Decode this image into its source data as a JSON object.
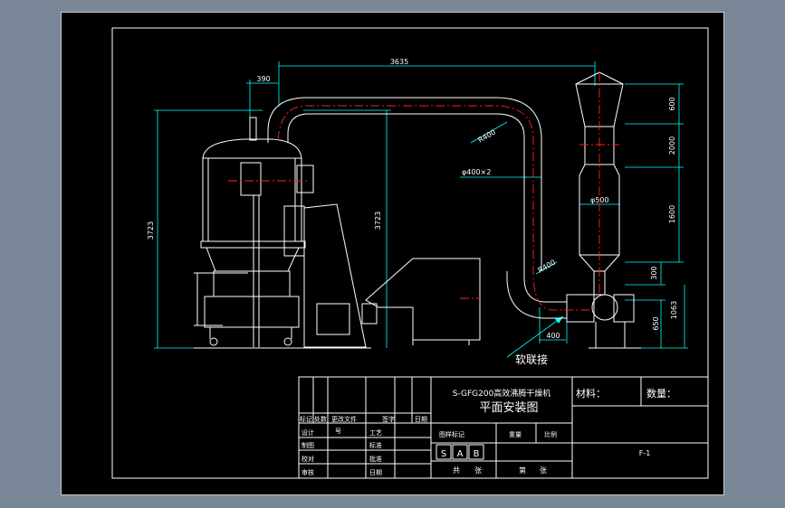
{
  "colors": {
    "background": "#000000",
    "frame": "#ffffff",
    "dimension": "#00ffff",
    "centerline": "#ff2020",
    "outside": "#7a8798"
  },
  "dimensions": {
    "total_length": "3635",
    "offset": "390",
    "height_left": "3723",
    "height_mid": "3723",
    "bend_top": "R400",
    "pipe": "φ400×2",
    "bend_bottom": "R400",
    "fan_offset": "400",
    "chimney_dia": "φ500",
    "right_dims": [
      "600",
      "2000",
      "1600",
      "300"
    ],
    "fan_height": "650",
    "base_height": "1063"
  },
  "callout": "软联接",
  "title_block": {
    "machine_name": "S-GFG200高效沸腾干燥机",
    "drawing_title": "平面安装图",
    "material_label": "材料：",
    "quantity_label": "数量：",
    "revision_headers": [
      "标记",
      "处数",
      "更改文件",
      "号",
      "签",
      "字",
      "日期"
    ],
    "designer_labels": [
      "设计",
      "制图",
      "校对",
      "审核"
    ],
    "process_labels": [
      "工艺",
      "标准",
      "批准",
      "日期"
    ],
    "stage_label": "图样标记",
    "weight_label": "重量",
    "scale_label": "比例",
    "stage_marks": [
      "S",
      "A",
      "B"
    ],
    "total_label": "共",
    "sheet_label": "第",
    "zhang": "张",
    "drawing_number": "F-1"
  }
}
